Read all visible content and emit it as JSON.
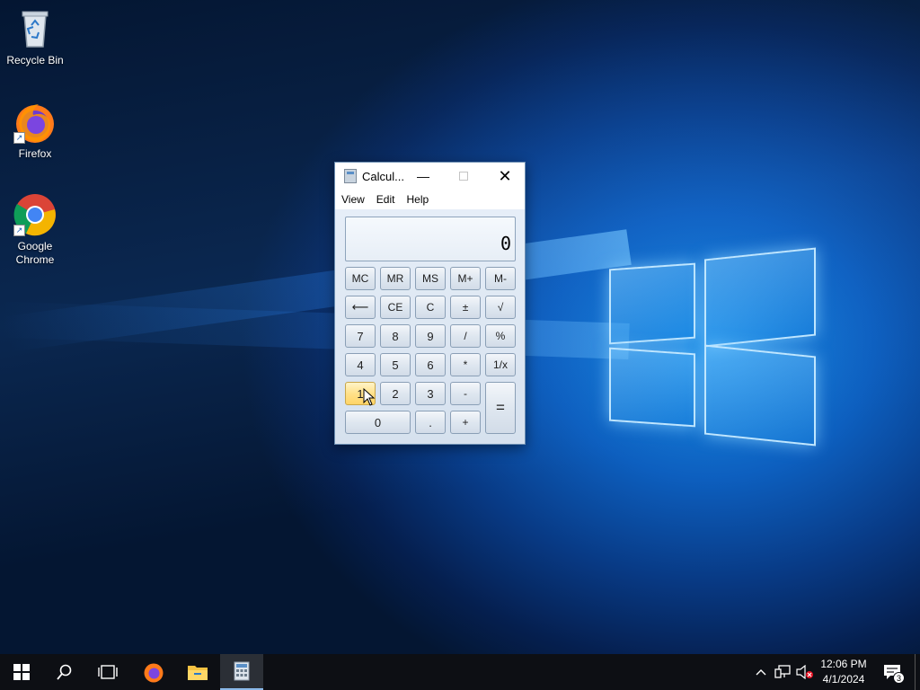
{
  "desktop": {
    "icons": [
      {
        "label": "Recycle Bin"
      },
      {
        "label": "Firefox"
      },
      {
        "label": "Google Chrome"
      }
    ]
  },
  "calculator": {
    "title": "Calcul...",
    "menu": [
      "View",
      "Edit",
      "Help"
    ],
    "display_value": "0",
    "keys": {
      "mc": "MC",
      "mr": "MR",
      "ms": "MS",
      "mplus": "M+",
      "mminus": "M-",
      "back": "⟵",
      "ce": "CE",
      "c": "C",
      "pm": "±",
      "sqrt": "√",
      "k7": "7",
      "k8": "8",
      "k9": "9",
      "div": "/",
      "pct": "%",
      "k4": "4",
      "k5": "5",
      "k6": "6",
      "mul": "*",
      "recip": "1/x",
      "k1": "1",
      "k2": "2",
      "k3": "3",
      "sub": "-",
      "k0": "0",
      "dot": ".",
      "add": "+",
      "eq": "="
    }
  },
  "taskbar": {
    "clock_time": "12:06 PM",
    "clock_date": "4/1/2024",
    "notification_count": "3"
  },
  "colors": {
    "taskbar_bg": "#0d0f14",
    "accent": "#1a8fe8"
  }
}
